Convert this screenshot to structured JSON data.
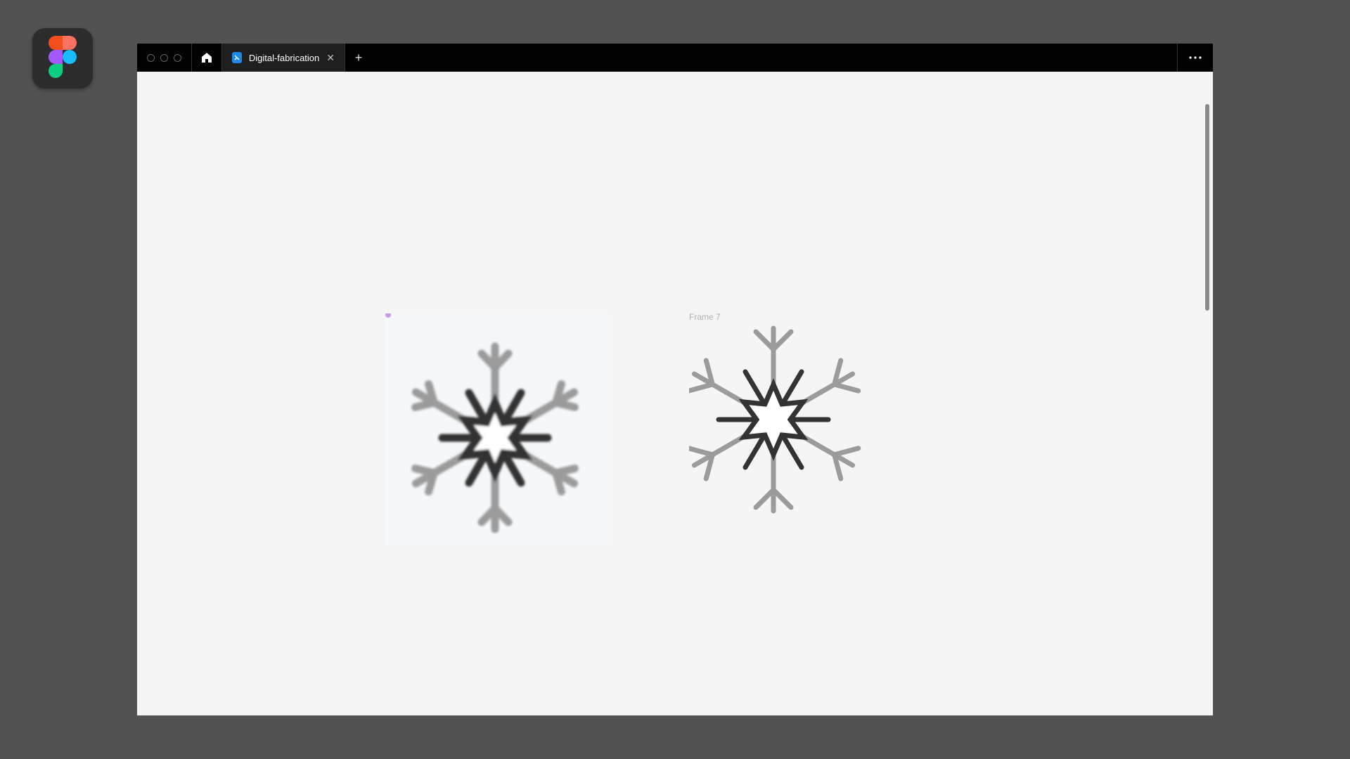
{
  "app": {
    "icon": "figma-logo-icon"
  },
  "titlebar": {
    "home_icon": "home-icon",
    "tab": {
      "label": "Digital-fabrication",
      "icon": "figma-file-icon",
      "close": "✕"
    },
    "new_tab": "+",
    "more_icon": "more-horizontal-icon"
  },
  "canvas": {
    "frame_label": "Frame 7",
    "image_frame_icon": "snowflake-icon",
    "vector_frame_icon": "snowflake-icon"
  },
  "colors": {
    "background": "#525252",
    "canvas": "#f5f5f5",
    "snowflake_outer": "#9b9b9b",
    "snowflake_inner": "#333333"
  }
}
